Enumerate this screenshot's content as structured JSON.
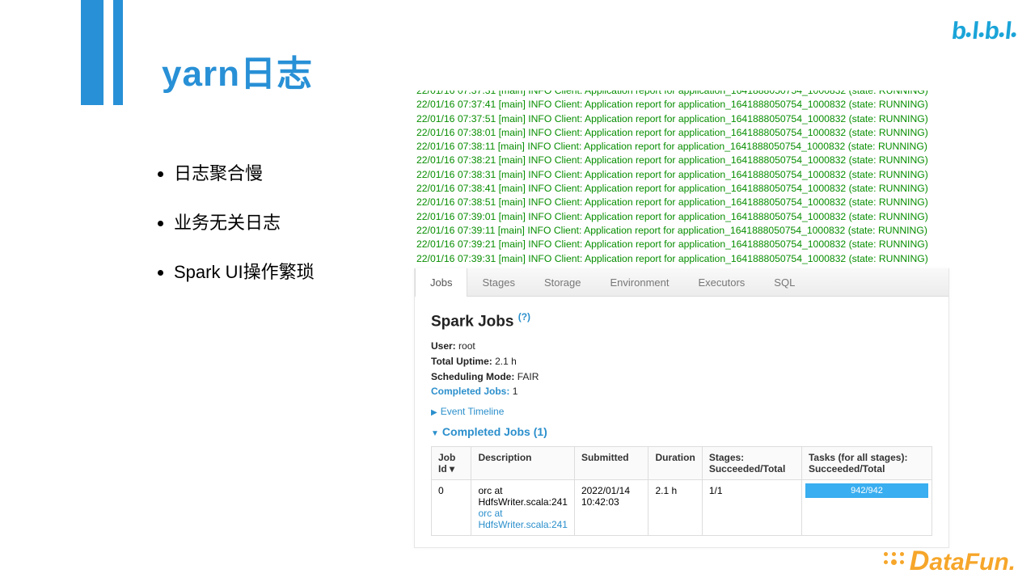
{
  "title": "yarn日志",
  "bullets": [
    "日志聚合慢",
    "业务无关日志",
    "Spark UI操作繁琐"
  ],
  "log_lines": [
    "22/01/16 07:37:41 [main] INFO Client: Application report for application_1641888050754_1000832 (state: RUNNING)",
    "22/01/16 07:37:51 [main] INFO Client: Application report for application_1641888050754_1000832 (state: RUNNING)",
    "22/01/16 07:38:01 [main] INFO Client: Application report for application_1641888050754_1000832 (state: RUNNING)",
    "22/01/16 07:38:11 [main] INFO Client: Application report for application_1641888050754_1000832 (state: RUNNING)",
    "22/01/16 07:38:21 [main] INFO Client: Application report for application_1641888050754_1000832 (state: RUNNING)",
    "22/01/16 07:38:31 [main] INFO Client: Application report for application_1641888050754_1000832 (state: RUNNING)",
    "22/01/16 07:38:41 [main] INFO Client: Application report for application_1641888050754_1000832 (state: RUNNING)",
    "22/01/16 07:38:51 [main] INFO Client: Application report for application_1641888050754_1000832 (state: RUNNING)",
    "22/01/16 07:39:01 [main] INFO Client: Application report for application_1641888050754_1000832 (state: RUNNING)",
    "22/01/16 07:39:11 [main] INFO Client: Application report for application_1641888050754_1000832 (state: RUNNING)",
    "22/01/16 07:39:21 [main] INFO Client: Application report for application_1641888050754_1000832 (state: RUNNING)"
  ],
  "spark": {
    "tabs": [
      "Jobs",
      "Stages",
      "Storage",
      "Environment",
      "Executors",
      "SQL"
    ],
    "active_tab": "Jobs",
    "heading": "Spark Jobs ",
    "heading_q": "(?)",
    "kv": {
      "user_label": "User:",
      "user_val": "root",
      "uptime_label": "Total Uptime:",
      "uptime_val": "2.1 h",
      "sched_label": "Scheduling Mode:",
      "sched_val": "FAIR",
      "completed_label": "Completed Jobs:",
      "completed_val": "1"
    },
    "event_timeline": "Event Timeline",
    "completed_header": "Completed Jobs (1)",
    "table": {
      "headers": [
        "Job Id ▾",
        "Description",
        "Submitted",
        "Duration",
        "Stages: Succeeded/Total",
        "Tasks (for all stages): Succeeded/Total"
      ],
      "row": {
        "job_id": "0",
        "desc1": "orc at HdfsWriter.scala:241",
        "desc2": "orc at HdfsWriter.scala:241",
        "submitted1": "2022/01/14",
        "submitted2": "10:42:03",
        "duration": "2.1 h",
        "stages": "1/1",
        "tasks": "942/942"
      }
    }
  },
  "logos": {
    "bilibili": "bilibili",
    "datafun": "DataFun."
  }
}
